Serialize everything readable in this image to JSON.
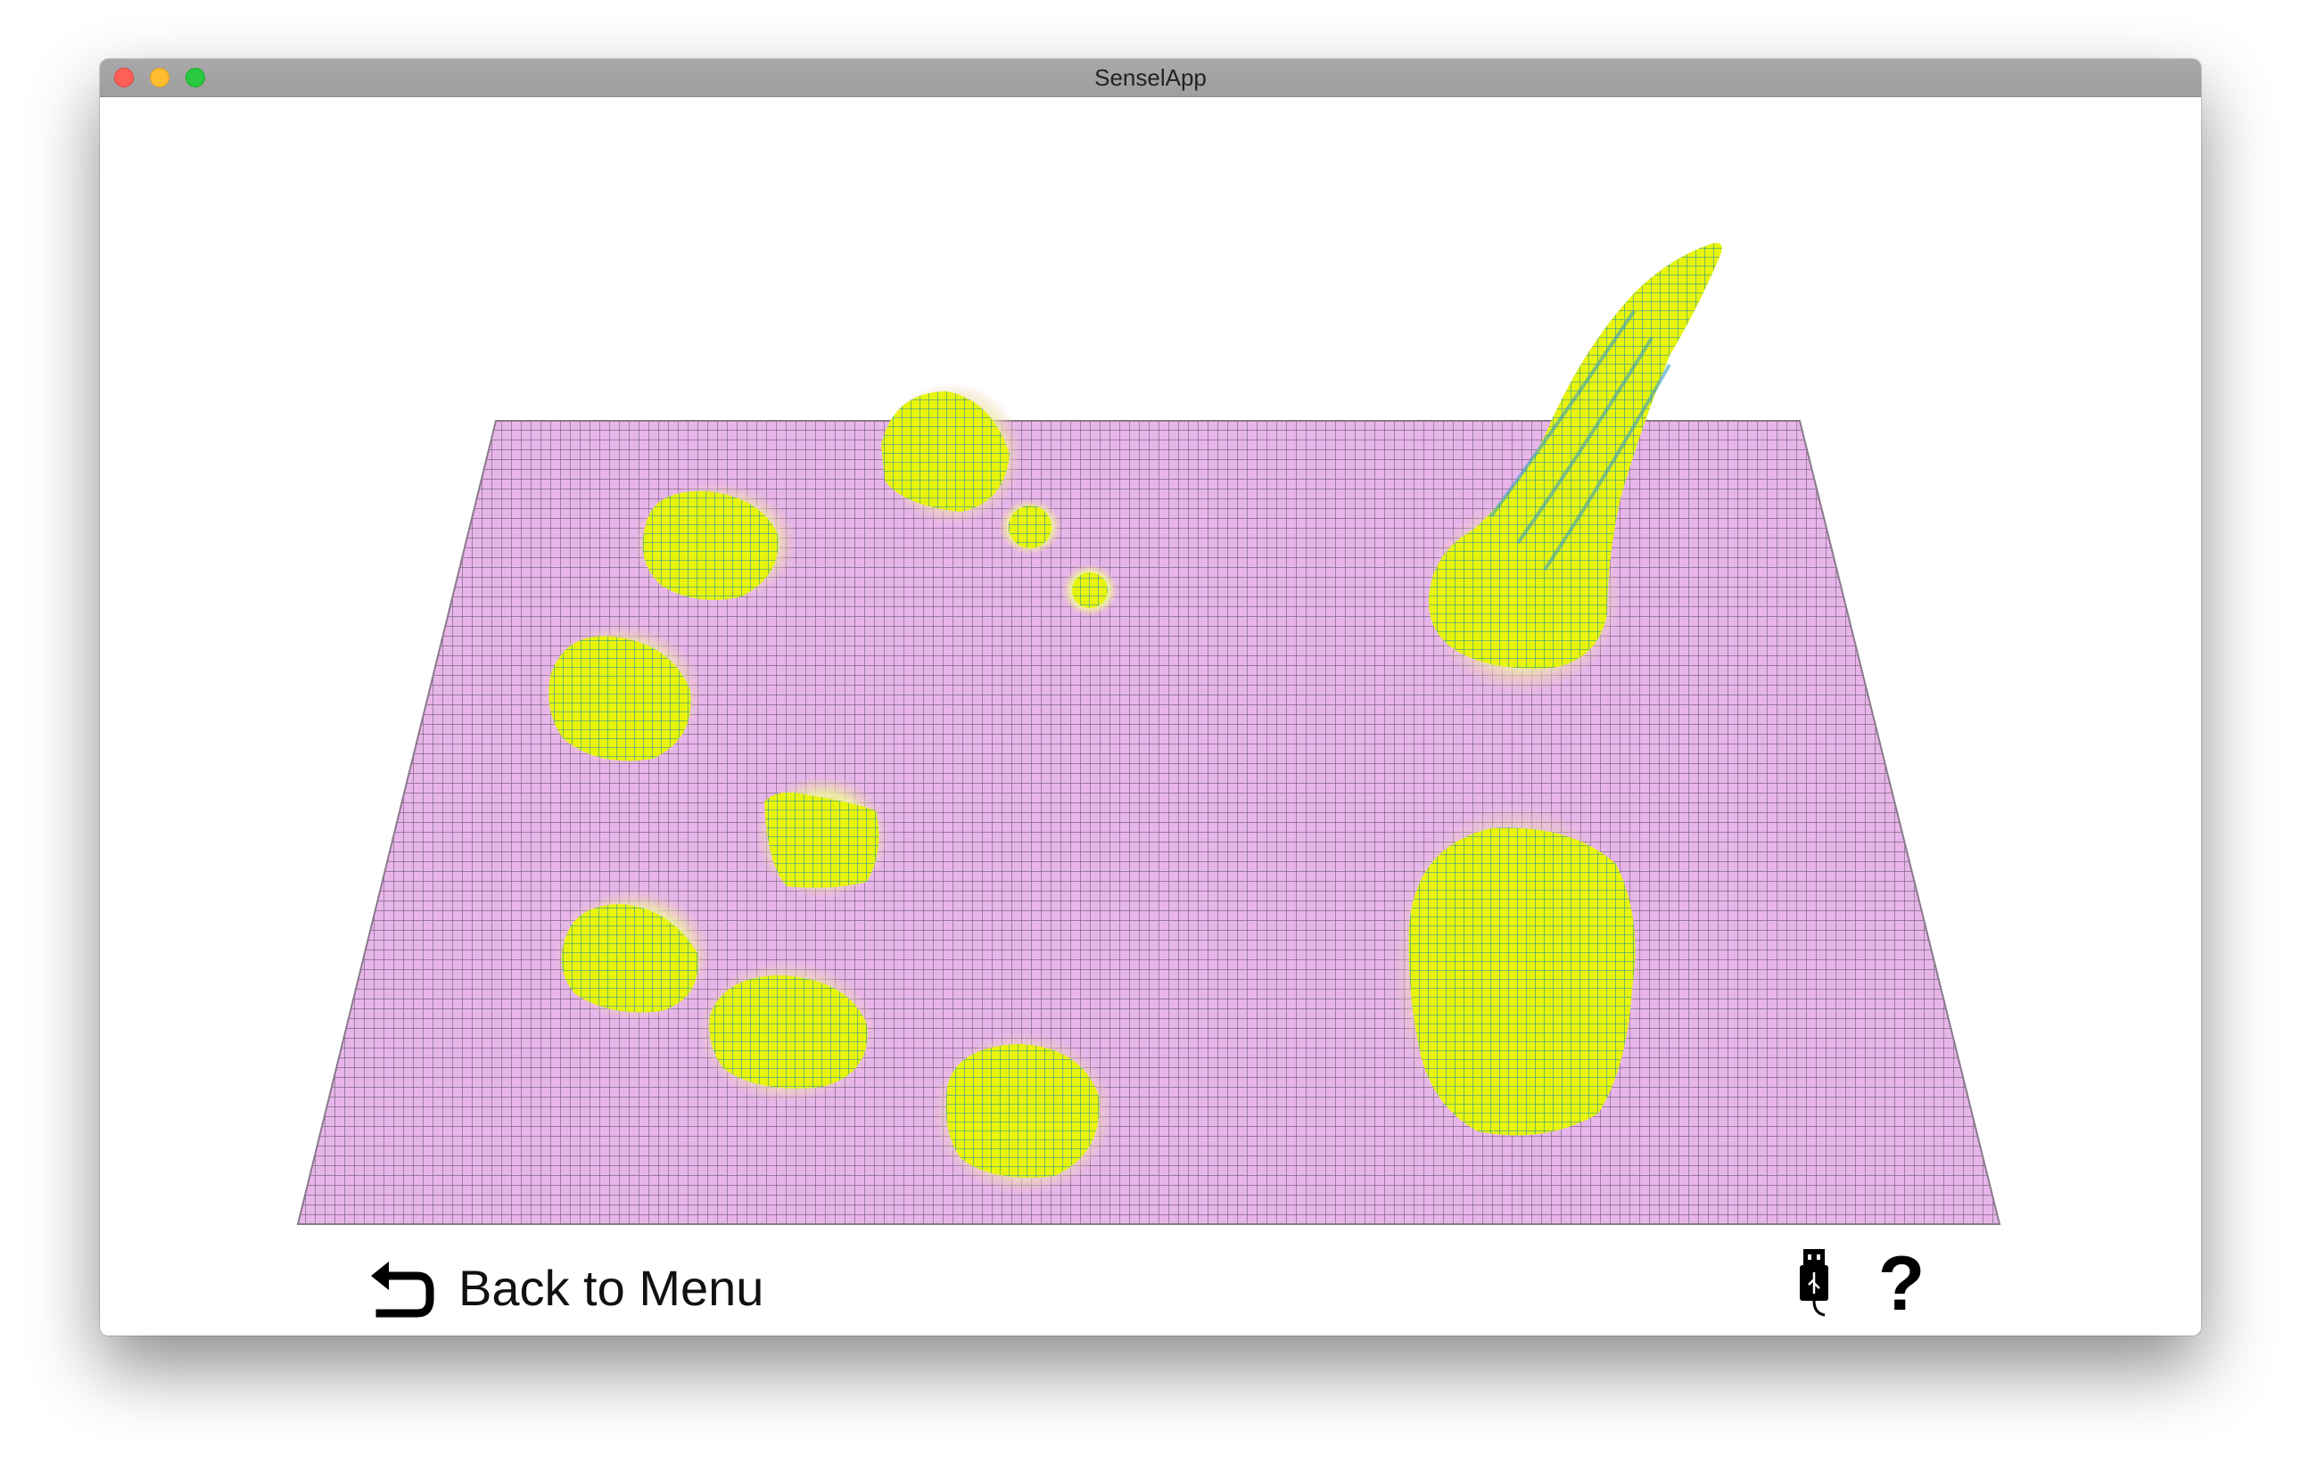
{
  "window": {
    "title": "SenselApp"
  },
  "footer": {
    "back_label": "Back to Menu",
    "help_label": "?"
  },
  "icons": {
    "back": "return-arrow-icon",
    "usb": "usb-connection-icon",
    "close": "close-icon",
    "minimize": "minimize-icon",
    "maximize": "maximize-icon"
  },
  "colors": {
    "grid_base": "#e8b5ea",
    "grid_line": "#7a6a80",
    "peak_fill": "#e6f20a",
    "peak_line": "#2aa7a0",
    "halo": "#f4d0a8"
  }
}
